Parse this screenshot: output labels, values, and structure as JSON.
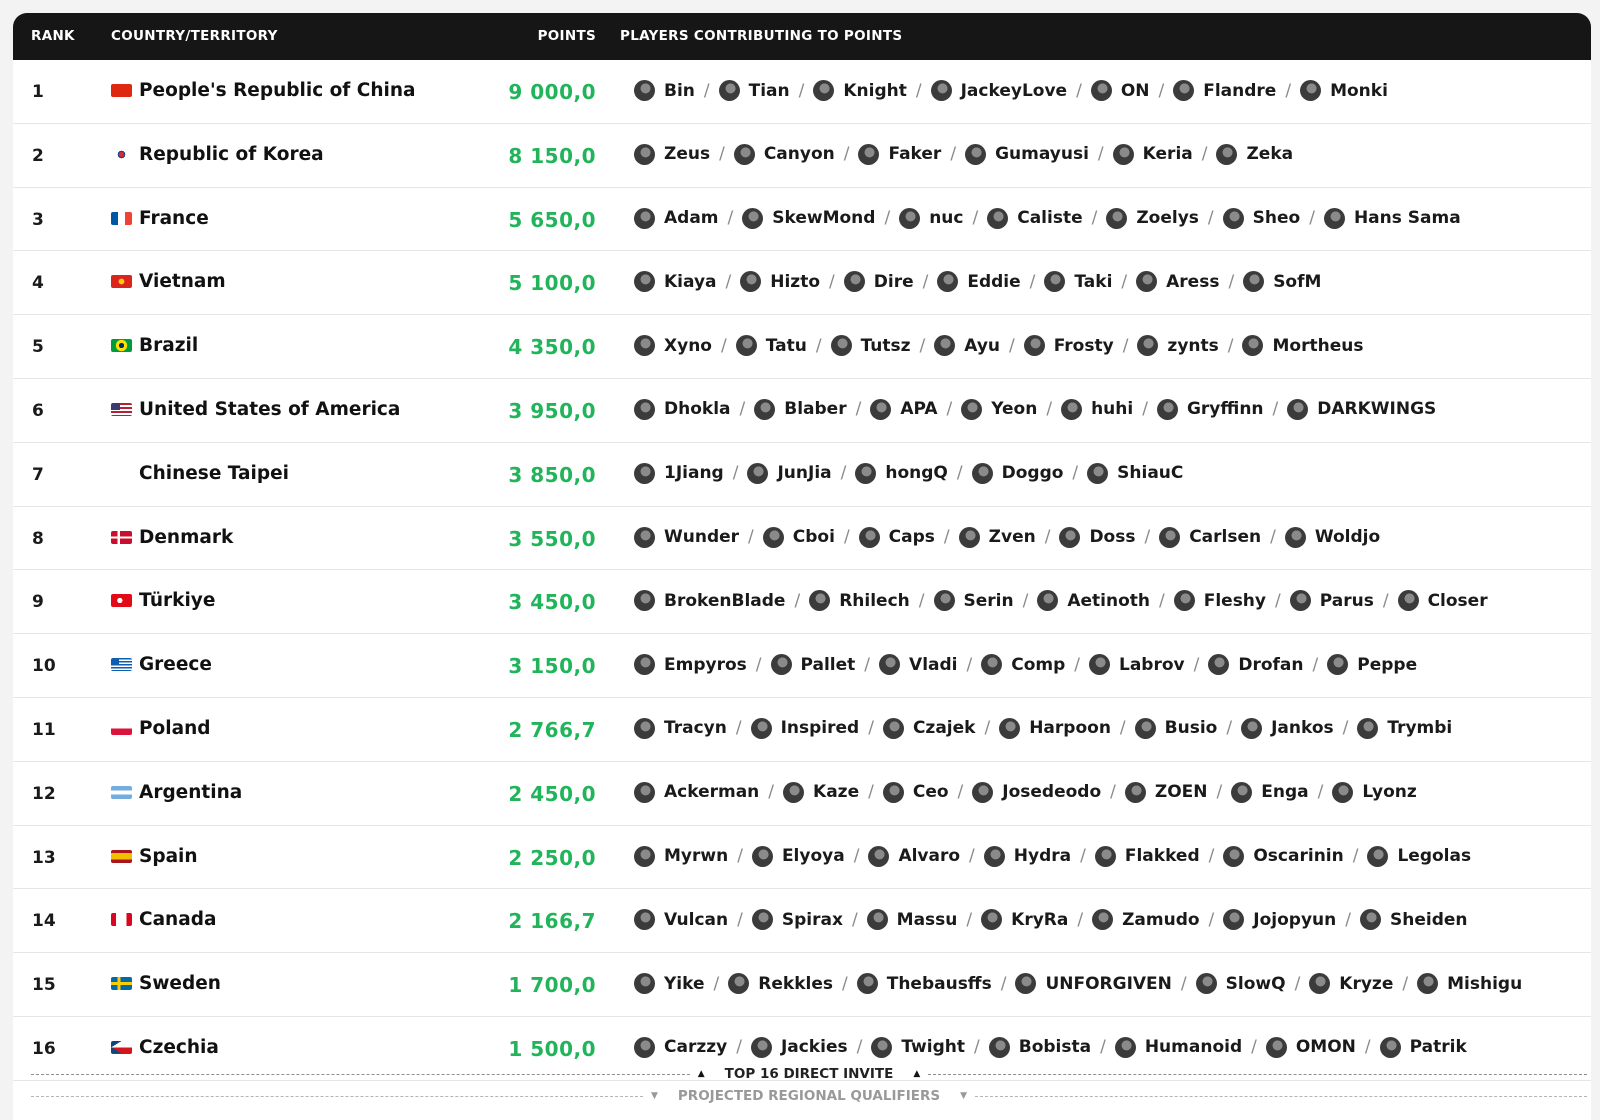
{
  "header": {
    "rank": "RANK",
    "country": "COUNTRY/TERRITORY",
    "points": "POINTS",
    "players": "PLAYERS CONTRIBUTING TO POINTS"
  },
  "rows": [
    {
      "rank": "1",
      "country": "People's Republic of China",
      "flag": "china",
      "points": "9 000,0",
      "players": [
        "Bin",
        "Tian",
        "Knight",
        "JackeyLove",
        "ON",
        "Flandre",
        "Monki"
      ]
    },
    {
      "rank": "2",
      "country": "Republic of Korea",
      "flag": "korea",
      "points": "8 150,0",
      "players": [
        "Zeus",
        "Canyon",
        "Faker",
        "Gumayusi",
        "Keria",
        "Zeka"
      ]
    },
    {
      "rank": "3",
      "country": "France",
      "flag": "france",
      "points": "5 650,0",
      "players": [
        "Adam",
        "SkewMond",
        "nuc",
        "Caliste",
        "Zoelys",
        "Sheo",
        "Hans Sama"
      ]
    },
    {
      "rank": "4",
      "country": "Vietnam",
      "flag": "vietnam",
      "points": "5 100,0",
      "players": [
        "Kiaya",
        "Hizto",
        "Dire",
        "Eddie",
        "Taki",
        "Aress",
        "SofM"
      ]
    },
    {
      "rank": "5",
      "country": "Brazil",
      "flag": "brazil",
      "points": "4 350,0",
      "players": [
        "Xyno",
        "Tatu",
        "Tutsz",
        "Ayu",
        "Frosty",
        "zynts",
        "Mortheus"
      ]
    },
    {
      "rank": "6",
      "country": "United States of America",
      "flag": "usa",
      "points": "3 950,0",
      "players": [
        "Dhokla",
        "Blaber",
        "APA",
        "Yeon",
        "huhi",
        "Gryffinn",
        "DARKWINGS"
      ]
    },
    {
      "rank": "7",
      "country": "Chinese Taipei",
      "flag": "taipei",
      "points": "3 850,0",
      "players": [
        "1Jiang",
        "JunJia",
        "hongQ",
        "Doggo",
        "ShiauC"
      ]
    },
    {
      "rank": "8",
      "country": "Denmark",
      "flag": "denmark",
      "points": "3 550,0",
      "players": [
        "Wunder",
        "Cboi",
        "Caps",
        "Zven",
        "Doss",
        "Carlsen",
        "Woldjo"
      ]
    },
    {
      "rank": "9",
      "country": "Türkiye",
      "flag": "turkiye",
      "points": "3 450,0",
      "players": [
        "BrokenBlade",
        "Rhilech",
        "Serin",
        "Aetinoth",
        "Fleshy",
        "Parus",
        "Closer"
      ]
    },
    {
      "rank": "10",
      "country": "Greece",
      "flag": "greece",
      "points": "3 150,0",
      "players": [
        "Empyros",
        "Pallet",
        "Vladi",
        "Comp",
        "Labrov",
        "Drofan",
        "Peppe"
      ]
    },
    {
      "rank": "11",
      "country": "Poland",
      "flag": "poland",
      "points": "2 766,7",
      "players": [
        "Tracyn",
        "Inspired",
        "Czajek",
        "Harpoon",
        "Busio",
        "Jankos",
        "Trymbi"
      ]
    },
    {
      "rank": "12",
      "country": "Argentina",
      "flag": "argentina",
      "points": "2 450,0",
      "players": [
        "Ackerman",
        "Kaze",
        "Ceo",
        "Josedeodo",
        "ZOEN",
        "Enga",
        "Lyonz"
      ]
    },
    {
      "rank": "13",
      "country": "Spain",
      "flag": "spain",
      "points": "2 250,0",
      "players": [
        "Myrwn",
        "Elyoya",
        "Alvaro",
        "Hydra",
        "Flakked",
        "Oscarinin",
        "Legolas"
      ]
    },
    {
      "rank": "14",
      "country": "Canada",
      "flag": "canada",
      "points": "2 166,7",
      "players": [
        "Vulcan",
        "Spirax",
        "Massu",
        "KryRa",
        "Zamudo",
        "Jojopyun",
        "Sheiden"
      ]
    },
    {
      "rank": "15",
      "country": "Sweden",
      "flag": "sweden",
      "points": "1 700,0",
      "players": [
        "Yike",
        "Rekkles",
        "Thebausffs",
        "UNFORGIVEN",
        "SlowQ",
        "Kryze",
        "Mishigu"
      ]
    },
    {
      "rank": "16",
      "country": "Czechia",
      "flag": "czechia",
      "points": "1 500,0",
      "players": [
        "Carzzy",
        "Jackies",
        "Twight",
        "Bobista",
        "Humanoid",
        "OMON",
        "Patrik"
      ]
    }
  ],
  "dividers": {
    "direct_invite": "TOP 16 DIRECT INVITE",
    "regional": "PROJECTED REGIONAL QUALIFIERS"
  },
  "colors": {
    "header_bg": "#161616",
    "points_green": "#21b45a"
  }
}
